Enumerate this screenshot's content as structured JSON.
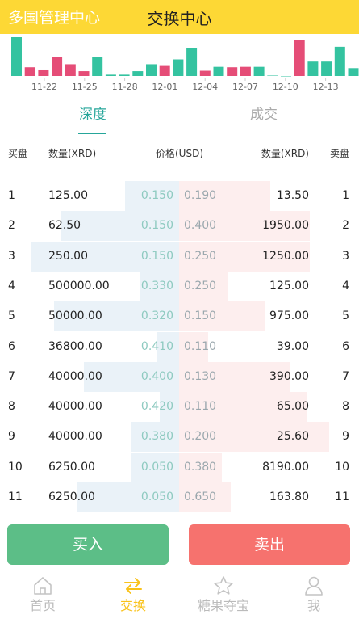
{
  "header": {
    "app_name": "多国管理中心",
    "title": "交换中心"
  },
  "chart_data": {
    "type": "bar",
    "x_labels": [
      "11-22",
      "11-25",
      "11-28",
      "12-01",
      "12-04",
      "12-07",
      "12-10",
      "12-13"
    ],
    "values": [
      8.9,
      2.0,
      1.3,
      4.4,
      2.7,
      1.1,
      4.4,
      0.3,
      0.3,
      1.1,
      2.7,
      2.3,
      3.8,
      6.4,
      1.2,
      2.1,
      2.0,
      2.1,
      2.1,
      0.1,
      0,
      8.2,
      3.3,
      3.3,
      6.7,
      1.8
    ],
    "colors": [
      "#34c3a0",
      "#e54d77",
      "#e54d77",
      "#e54d77",
      "#e54d77",
      "#e54d77",
      "#34c3a0",
      "#34c3a0",
      "#34c3a0",
      "#34c3a0",
      "#34c3a0",
      "#e54d77",
      "#34c3a0",
      "#34c3a0",
      "#e54d77",
      "#34c3a0",
      "#e54d77",
      "#e54d77",
      "#34c3a0",
      "#34c3a0",
      "#34c3a0",
      "#e54d77",
      "#34c3a0",
      "#34c3a0",
      "#34c3a0",
      "#34c3a0"
    ]
  },
  "tabs": [
    {
      "label": "深度"
    },
    {
      "label": "成交"
    }
  ],
  "book_header": {
    "buy": "买盘",
    "buy_qty": "数量(XRD)",
    "price": "价格(USD)",
    "sell_qty": "数量(XRD)",
    "sell": "卖盘"
  },
  "rows": [
    {
      "idx": "1",
      "buy_qty": "125.00",
      "buy_price": "0.150",
      "sell_price": "0.190",
      "sell_qty": "13.50",
      "sell_idx": "1",
      "buy_depth": 0.3,
      "sell_depth": 0.51
    },
    {
      "idx": "2",
      "buy_qty": "62.50",
      "buy_price": "0.150",
      "sell_price": "0.400",
      "sell_qty": "1950.00",
      "sell_idx": "2",
      "buy_depth": 0.66,
      "sell_depth": 0.73
    },
    {
      "idx": "3",
      "buy_qty": "250.00",
      "buy_price": "0.150",
      "sell_price": "0.250",
      "sell_qty": "1250.00",
      "sell_idx": "3",
      "buy_depth": 0.83,
      "sell_depth": 0.73
    },
    {
      "idx": "4",
      "buy_qty": "500000.00",
      "buy_price": "0.330",
      "sell_price": "0.250",
      "sell_qty": "125.00",
      "sell_idx": "4",
      "buy_depth": 0.22,
      "sell_depth": 0.27
    },
    {
      "idx": "5",
      "buy_qty": "50000.00",
      "buy_price": "0.320",
      "sell_price": "0.150",
      "sell_qty": "975.00",
      "sell_idx": "5",
      "buy_depth": 0.7,
      "sell_depth": 0.48
    },
    {
      "idx": "6",
      "buy_qty": "36800.00",
      "buy_price": "0.410",
      "sell_price": "0.110",
      "sell_qty": "39.00",
      "sell_idx": "6",
      "buy_depth": 0.12,
      "sell_depth": 0.16
    },
    {
      "idx": "7",
      "buy_qty": "40000.00",
      "buy_price": "0.400",
      "sell_price": "0.130",
      "sell_qty": "390.00",
      "sell_idx": "7",
      "buy_depth": 0.53,
      "sell_depth": 0.62
    },
    {
      "idx": "8",
      "buy_qty": "40000.00",
      "buy_price": "0.420",
      "sell_price": "0.110",
      "sell_qty": "65.00",
      "sell_idx": "8",
      "buy_depth": 0.11,
      "sell_depth": 0.71
    },
    {
      "idx": "9",
      "buy_qty": "40000.00",
      "buy_price": "0.380",
      "sell_price": "0.200",
      "sell_qty": "25.60",
      "sell_idx": "9",
      "buy_depth": 0.27,
      "sell_depth": 0.84
    },
    {
      "idx": "10",
      "buy_qty": "6250.00",
      "buy_price": "0.050",
      "sell_price": "0.380",
      "sell_qty": "8190.00",
      "sell_idx": "10",
      "buy_depth": 0.27,
      "sell_depth": 0.24
    },
    {
      "idx": "11",
      "buy_qty": "6250.00",
      "buy_price": "0.050",
      "sell_price": "0.650",
      "sell_qty": "163.80",
      "sell_idx": "11",
      "buy_depth": 0.57,
      "sell_depth": 0.29
    }
  ],
  "actions": {
    "buy": "买入",
    "sell": "卖出"
  },
  "nav": [
    {
      "label": "首页",
      "icon": "home-icon",
      "active": false
    },
    {
      "label": "交换",
      "icon": "exchange-icon",
      "active": true
    },
    {
      "label": "糖果夺宝",
      "icon": "star-icon",
      "active": false
    },
    {
      "label": "我",
      "icon": "user-icon",
      "active": false
    }
  ],
  "colors": {
    "accent": "#fdd835",
    "up": "#34c3a0",
    "down": "#e54d77",
    "buy": "#5cbe87",
    "sell": "#f6726e",
    "active_nav": "#f9c21a"
  }
}
